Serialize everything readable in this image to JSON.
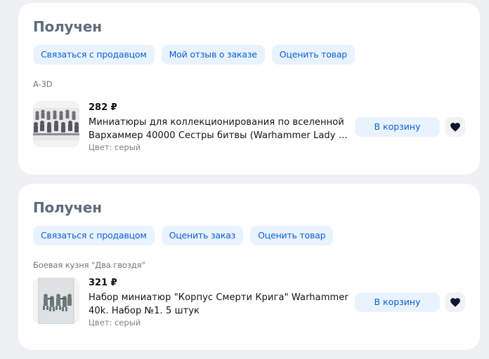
{
  "orders": [
    {
      "status": "Получен",
      "actions": [
        "Связаться с продавцом",
        "Мой отзыв о заказе",
        "Оценить товар"
      ],
      "seller": "A-3D",
      "item": {
        "price": "282 ₽",
        "title": "Миниатюры для коллекционирования по вселенной Вархаммер 40000 Сестры битвы (Warhammer Lady of Sisters of Battle)",
        "color": "Цвет: серый",
        "cart_label": "В корзину",
        "thumb_icon": "miniatures-photo"
      }
    },
    {
      "status": "Получен",
      "actions": [
        "Связаться с продавцом",
        "Оценить заказ",
        "Оценить товар"
      ],
      "seller": "Боевая кузня \"Два гвоздя\"",
      "item": {
        "price": "321 ₽",
        "title": "Набор миниатюр \"Корпус Смерти Крига\" Warhammer 40k. Набор №1. 5 штук",
        "color": "Цвет: серый",
        "cart_label": "В корзину",
        "thumb_icon": "miniatures-photo"
      }
    }
  ],
  "icons": {
    "favorite": "heart-icon"
  },
  "colors": {
    "accent": "#0a5fd8",
    "button_bg": "#e9f3fd",
    "status_text": "#5f6b7a",
    "page_bg": "#eef0f3"
  }
}
